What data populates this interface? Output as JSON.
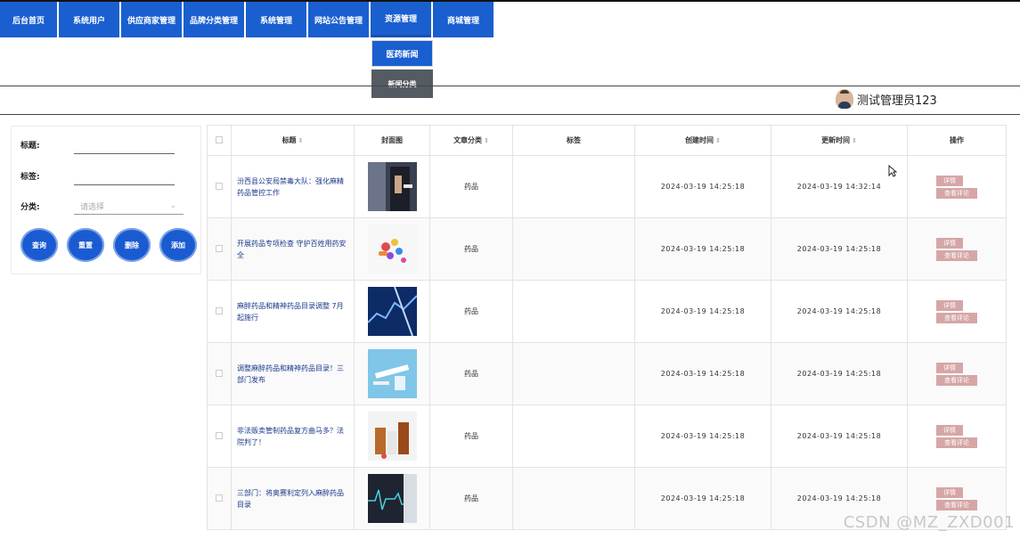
{
  "nav": {
    "items": [
      {
        "label": "后台首页",
        "width": 64
      },
      {
        "label": "系统用户",
        "width": 68
      },
      {
        "label": "供应商家管理",
        "width": 68
      },
      {
        "label": "品牌分类管理",
        "width": 68
      },
      {
        "label": "系统管理",
        "width": 68
      },
      {
        "label": "网站公告管理",
        "width": 68
      },
      {
        "label": "资源管理",
        "width": 68
      },
      {
        "label": "商城管理",
        "width": 68
      }
    ],
    "active": "资源管理"
  },
  "dropdown": {
    "items": [
      "医药新闻",
      "新闻分类"
    ]
  },
  "user": {
    "name": "测试管理员123"
  },
  "search": {
    "title_label": "标题:",
    "tags_label": "标签:",
    "category_label": "分类:",
    "category_placeholder": "请选择",
    "buttons": {
      "query": "查询",
      "reset": "重置",
      "delete": "删除",
      "add": "添加"
    }
  },
  "table": {
    "headers": {
      "title": "标题",
      "cover": "封面图",
      "category": "文章分类",
      "tags": "标签",
      "created": "创建时间",
      "updated": "更新时间",
      "ops": "操作"
    },
    "rows": [
      {
        "title": "汾西县公安局禁毒大队：强化麻精药品管控工作",
        "category": "药品",
        "tags": "",
        "created": "2024-03-19 14:25:18",
        "updated": "2024-03-19 14:32:14",
        "thumb": "businessman"
      },
      {
        "title": "开展药品专项检查 守护百姓用药安全",
        "category": "药品",
        "tags": "",
        "created": "2024-03-19 14:25:18",
        "updated": "2024-03-19 14:25:18",
        "thumb": "pills"
      },
      {
        "title": "麻醉药品和精神药品目录调整 7月起施行",
        "category": "药品",
        "tags": "",
        "created": "2024-03-19 14:25:18",
        "updated": "2024-03-19 14:25:18",
        "thumb": "chart"
      },
      {
        "title": "调整麻醉药品和精神药品目录！三部门发布",
        "category": "药品",
        "tags": "",
        "created": "2024-03-19 14:25:18",
        "updated": "2024-03-19 14:25:18",
        "thumb": "syringe"
      },
      {
        "title": "非法贩卖管制药品复方曲马多？法院判了！",
        "category": "药品",
        "tags": "",
        "created": "2024-03-19 14:25:18",
        "updated": "2024-03-19 14:25:18",
        "thumb": "bottles"
      },
      {
        "title": "三部门：将奥赛利定列入麻醉药品目录",
        "category": "药品",
        "tags": "",
        "created": "2024-03-19 14:25:18",
        "updated": "2024-03-19 14:25:18",
        "thumb": "monitor"
      }
    ],
    "ops": {
      "detail": "详情",
      "comments": "查看评论"
    }
  },
  "watermark": "CSDN @MZ_ZXD001",
  "colors": {
    "nav_blue": "#1a5fd0",
    "submenu_gray": "#555b62",
    "op_button": "#d6a6a6"
  }
}
